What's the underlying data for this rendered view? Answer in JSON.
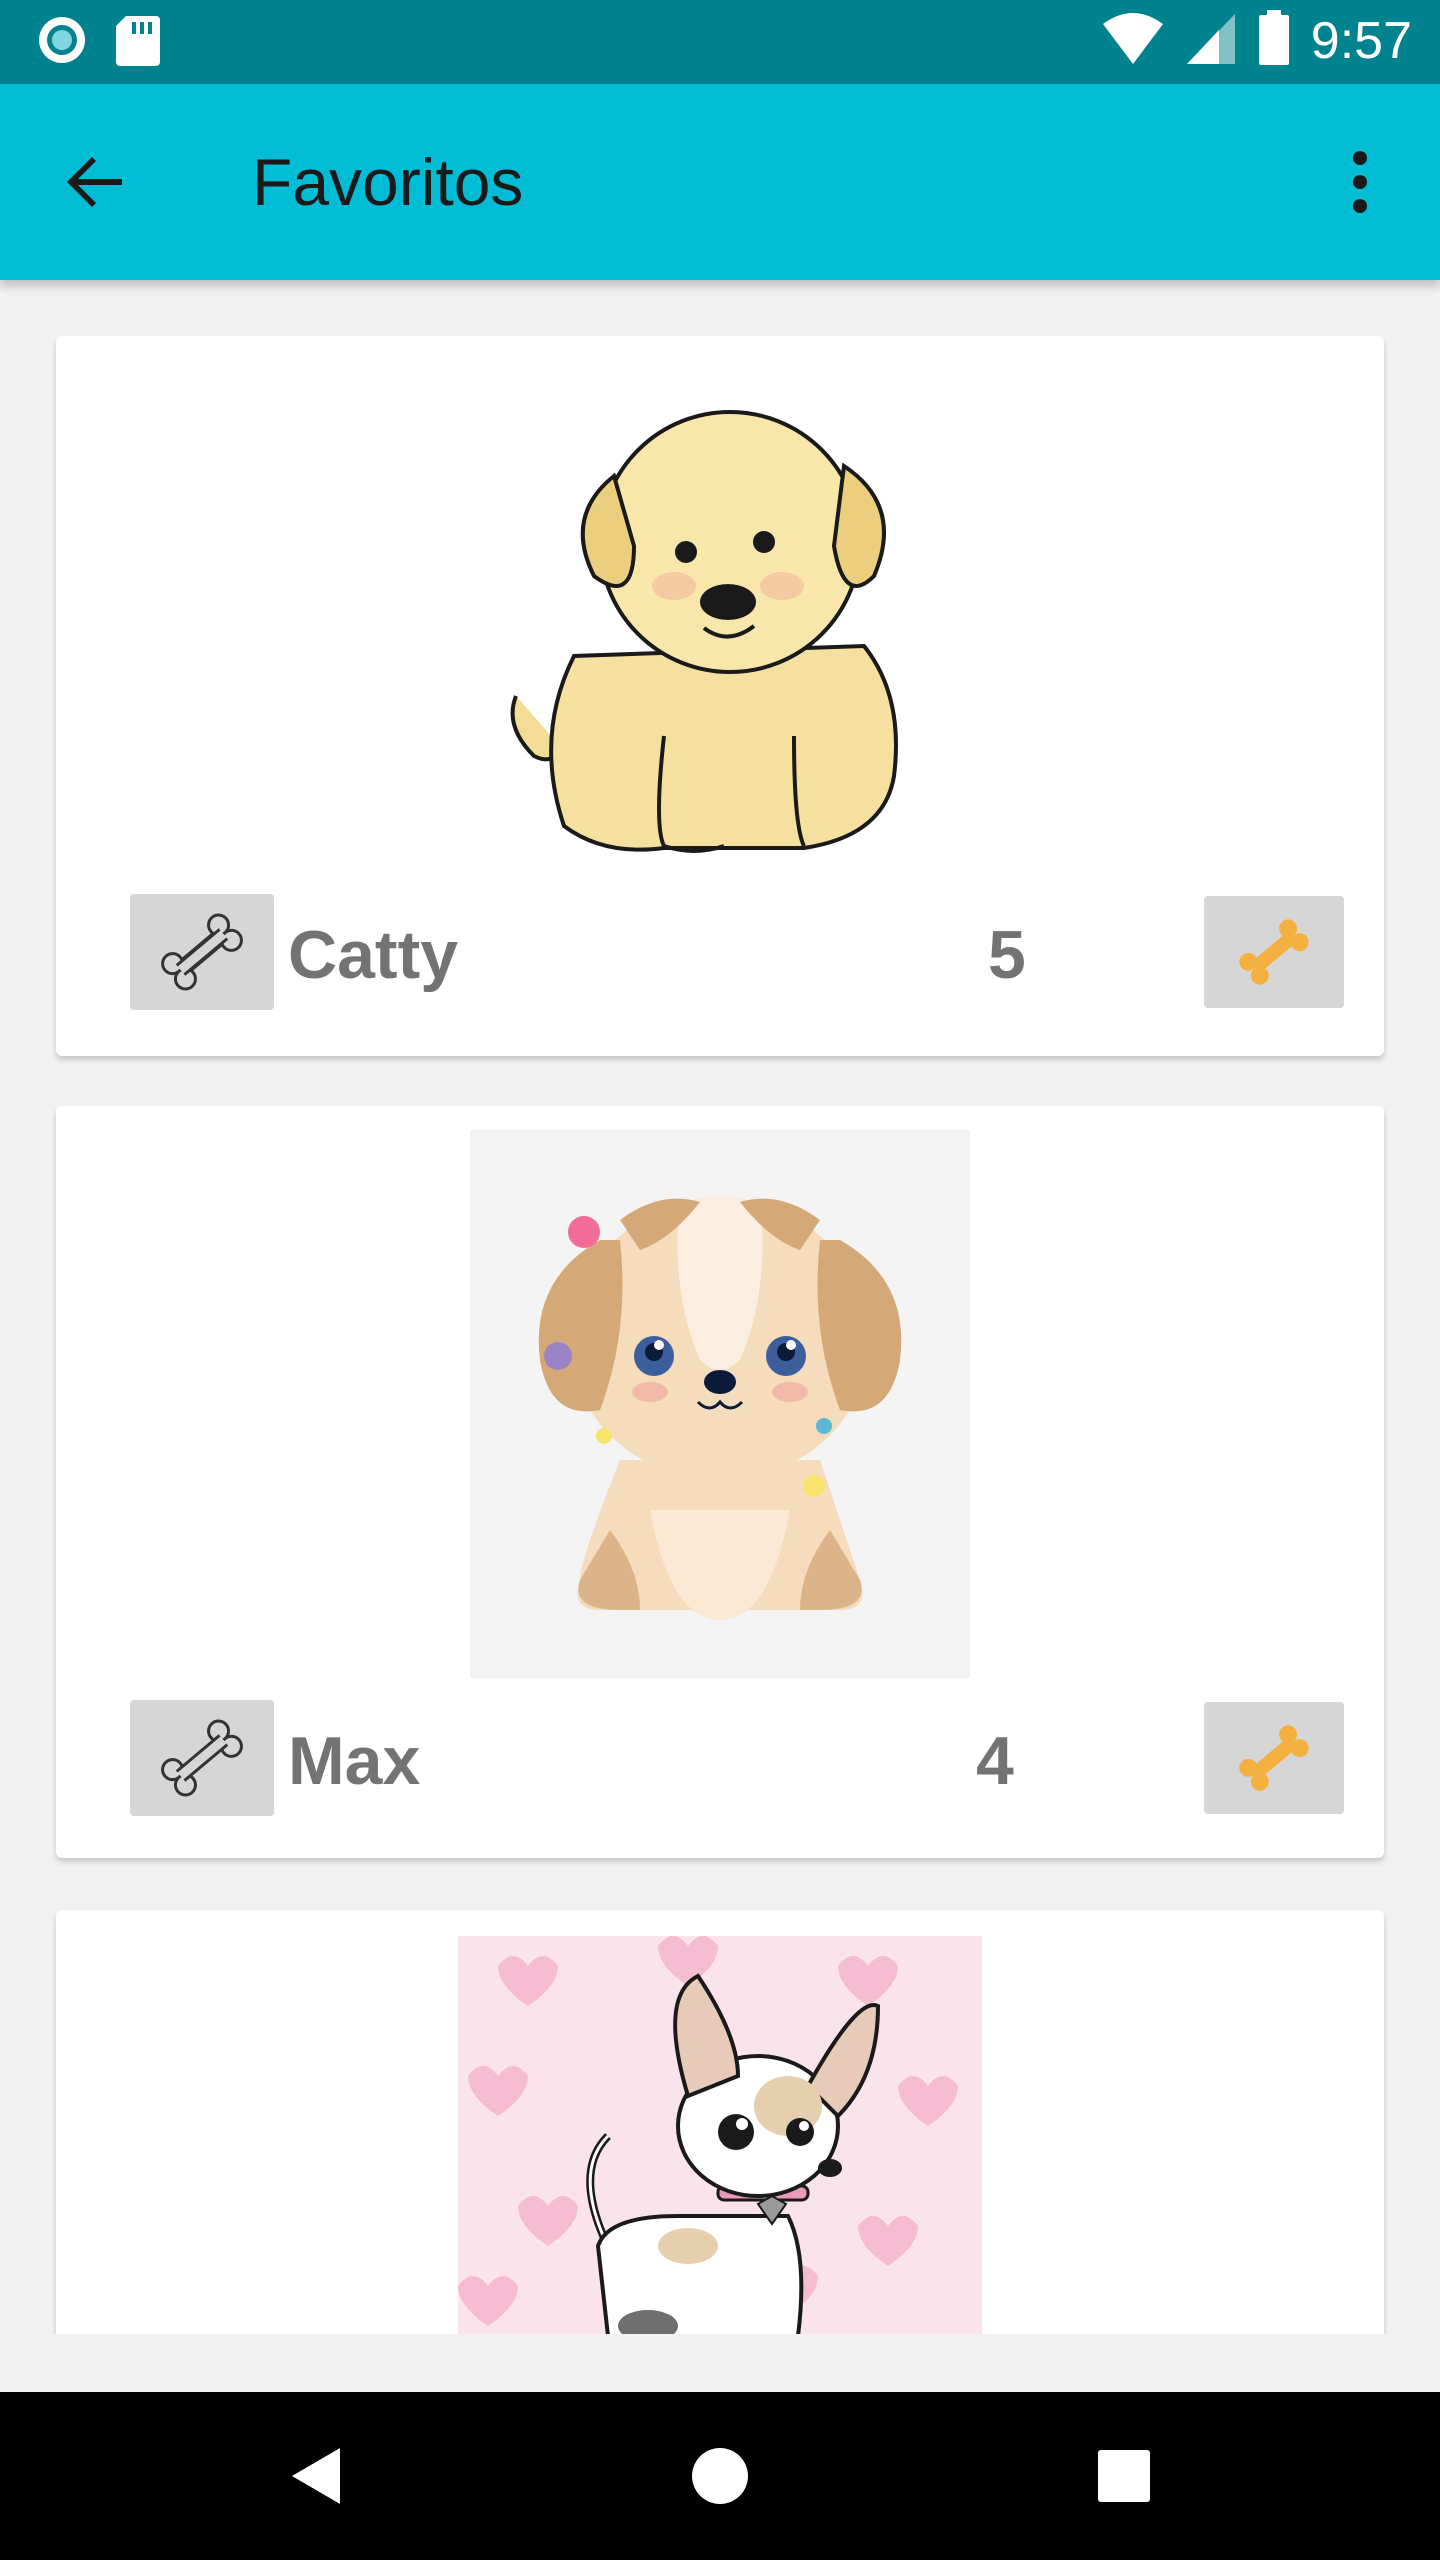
{
  "status_bar": {
    "time": "9:57",
    "icons": [
      "record-icon",
      "sd-card-icon",
      "wifi-icon",
      "signal-icon",
      "battery-icon"
    ]
  },
  "app_bar": {
    "title": "Favoritos",
    "back_icon": "arrow-back-icon",
    "menu_icon": "more-vert-icon"
  },
  "pets": [
    {
      "name": "Catty",
      "score": "5",
      "image": "yellow-puppy-image"
    },
    {
      "name": "Max",
      "score": "4",
      "image": "cream-puppy-image"
    },
    {
      "name": "",
      "score": "",
      "image": "chihuahua-image"
    }
  ],
  "colors": {
    "primary": "#00bcd4",
    "primary_dark": "#00838f",
    "bone_accent": "#f5b042",
    "text_gray": "#737373"
  },
  "nav_bar": {
    "icons": [
      "nav-back-icon",
      "nav-home-icon",
      "nav-recents-icon"
    ]
  }
}
